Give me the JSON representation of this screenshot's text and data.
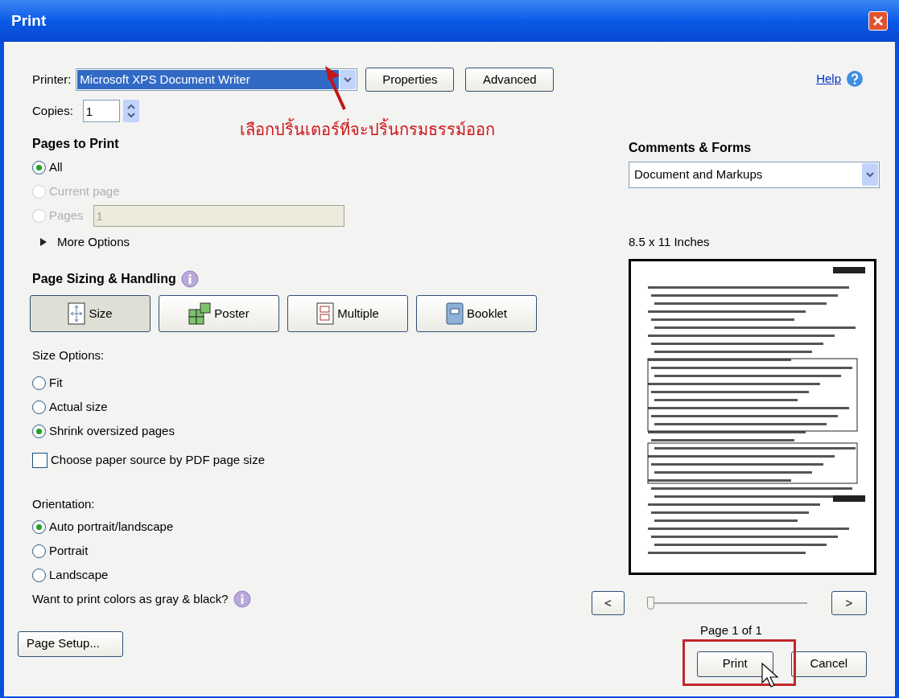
{
  "window": {
    "title": "Print"
  },
  "help_link": "Help",
  "printer": {
    "label": "Printer:",
    "value": "Microsoft XPS Document Writer"
  },
  "printer_buttons": [
    "Properties",
    "Advanced"
  ],
  "copies": {
    "label": "Copies:",
    "value": "1"
  },
  "annotation": "เลือกปริ้นเตอร์ที่จะปริ้นกรมธรรม์ออก",
  "pages_to_print": {
    "title": "Pages to Print",
    "options": [
      {
        "label": "All",
        "selected": true,
        "disabled": false
      },
      {
        "label": "Current page",
        "selected": false,
        "disabled": true
      },
      {
        "label": "Pages",
        "selected": false,
        "disabled": true
      }
    ],
    "range_value": "1",
    "more_options": "More Options"
  },
  "page_sizing": {
    "title": "Page Sizing & Handling",
    "modes": [
      {
        "label": "Size",
        "selected": true
      },
      {
        "label": "Poster",
        "selected": false
      },
      {
        "label": "Multiple",
        "selected": false
      },
      {
        "label": "Booklet",
        "selected": false
      }
    ]
  },
  "size_options": {
    "title": "Size Options:",
    "options": [
      {
        "label": "Fit",
        "selected": false
      },
      {
        "label": "Actual size",
        "selected": false
      },
      {
        "label": "Shrink oversized pages",
        "selected": true
      }
    ]
  },
  "paper_source": {
    "label": "Choose paper source by PDF page size",
    "checked": false
  },
  "orientation": {
    "title": "Orientation:",
    "options": [
      {
        "label": "Auto portrait/landscape",
        "selected": true
      },
      {
        "label": "Portrait",
        "selected": false
      },
      {
        "label": "Landscape",
        "selected": false
      }
    ]
  },
  "gray_question": "Want to print colors as gray & black?",
  "page_setup": "Page Setup...",
  "comments_forms": {
    "title": "Comments & Forms",
    "value": "Document and Markups"
  },
  "paper_size": "8.5 x 11 Inches",
  "navigation": {
    "prev": "<",
    "next": ">",
    "slider": {
      "level": 0
    }
  },
  "page_indicator": "Page 1 of 1",
  "actions": {
    "print": "Print",
    "cancel": "Cancel"
  }
}
